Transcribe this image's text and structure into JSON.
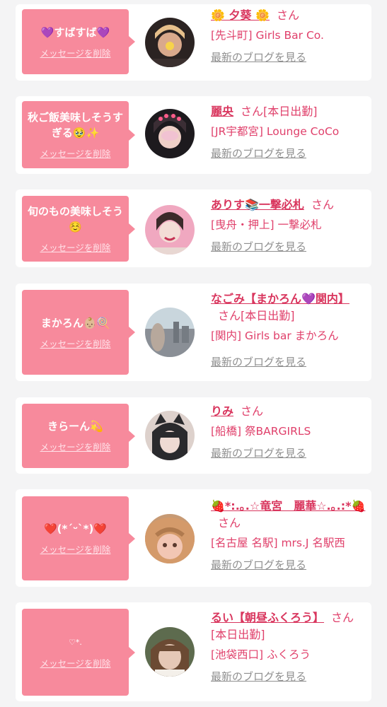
{
  "delete_label": "メッセージを削除",
  "blog_label": "最新のブログを見る",
  "san": "さん",
  "cards": [
    {
      "message": "💜すばすば💜",
      "name": "🌼 夕葵 🌼",
      "status": "",
      "shop": "[先斗町] Girls Bar Co.",
      "avatar_colors": [
        "#2b2322",
        "#d9a98c"
      ]
    },
    {
      "message": "秋ご飯美味しそうすぎる🥹✨",
      "name": "麗央",
      "status": "[本日出勤]",
      "shop": "[JR宇都宮] Lounge CoCo",
      "avatar_colors": [
        "#1d1a1e",
        "#f1c2d2"
      ]
    },
    {
      "message": "旬のもの美味しそう☺️",
      "name": "ありす📚一撃必札",
      "status": "",
      "shop": "[曳舟・押上] 一撃必札",
      "avatar_colors": [
        "#f0a8c0",
        "#e8d7d2"
      ]
    },
    {
      "message": "まかろん👶🏼🍭",
      "name": "なごみ【まかろん💜関内】",
      "status": "[本日出勤]",
      "shop": "[関内] Girls bar まかろん",
      "avatar_colors": [
        "#c9d6dd",
        "#8a8f96"
      ]
    },
    {
      "message": "きらーん💫",
      "name": "りみ",
      "status": "",
      "shop": "[船橋] 祭BARGIRLS",
      "avatar_colors": [
        "#2a2a2d",
        "#ddd1cc"
      ]
    },
    {
      "message": "❤️(*´ᵕ`*)❤️",
      "name": "🍓*:.｡.☆竜宮　麗華☆.｡.:*🍓",
      "status": "",
      "shop": "[名古屋 名駅] mrs.J 名駅西",
      "avatar_colors": [
        "#c79a74",
        "#f2c6b4"
      ]
    },
    {
      "message": "♡*.",
      "name": "るい【朝昼ふくろう】",
      "status": "[本日出勤]",
      "shop": "[池袋西口] ふくろう",
      "avatar_colors": [
        "#5d6b4e",
        "#e5c8b6"
      ]
    }
  ]
}
